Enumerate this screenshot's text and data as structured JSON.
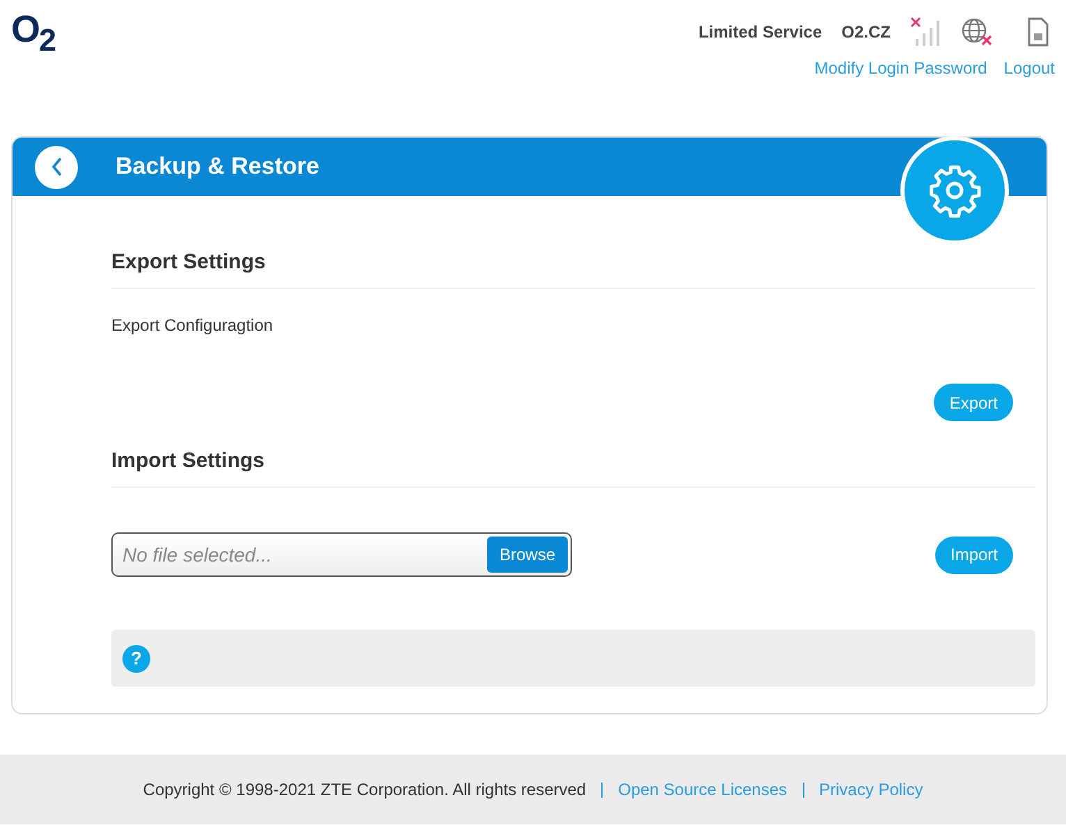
{
  "header": {
    "logo": "O$_{2}$",
    "status": "Limited Service",
    "network": "O2.CZ",
    "links": [
      {
        "label": "Modify Login Password"
      },
      {
        "label": "Logout"
      }
    ]
  },
  "panel": {
    "title": "Backup & Restore",
    "sections": [
      {
        "kind": "export",
        "heading": "Export Settings",
        "label": "Export Configuragtion",
        "button": "Export"
      },
      {
        "kind": "import",
        "heading": "Import Settings",
        "placeholder": "No file selected...",
        "browse": "Browse",
        "button": "Import"
      }
    ],
    "help": "?"
  },
  "footer": {
    "copyright": "Copyright © 1998-2021 ZTE Corporation. All rights reserved",
    "links": [
      {
        "label": "Open Source Licenses"
      },
      {
        "label": "Privacy Policy"
      }
    ]
  }
}
